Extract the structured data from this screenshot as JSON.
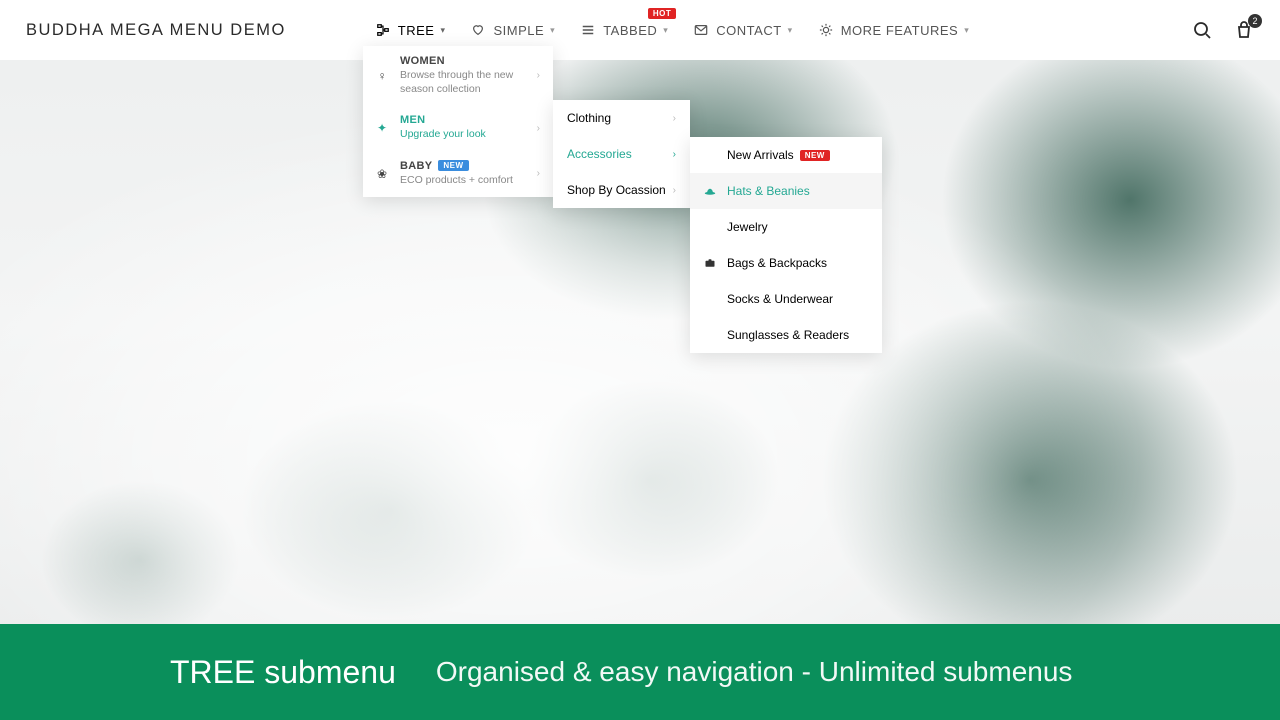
{
  "header": {
    "logo": "BUDDHA MEGA MENU DEMO",
    "nav": [
      {
        "label": "TREE",
        "icon": "tree"
      },
      {
        "label": "SIMPLE",
        "icon": "heart"
      },
      {
        "label": "TABBED",
        "icon": "lines",
        "badge": "HOT"
      },
      {
        "label": "CONTACT",
        "icon": "mail"
      },
      {
        "label": "MORE FEATURES",
        "icon": "bulb"
      }
    ],
    "cart_count": "2"
  },
  "tree_menu": {
    "level1": [
      {
        "title": "WOMEN",
        "sub": "Browse through the new season collection",
        "icon": "woman"
      },
      {
        "title": "MEN",
        "sub": "Upgrade your look",
        "icon": "man",
        "active": true
      },
      {
        "title": "BABY",
        "sub": "ECO products + comfort",
        "icon": "baby",
        "badge": "NEW"
      }
    ],
    "level2": [
      {
        "label": "Clothing"
      },
      {
        "label": "Accessories",
        "active": true
      },
      {
        "label": "Shop By Ocassion"
      }
    ],
    "level3": [
      {
        "label": "New Arrivals",
        "badge": "NEW"
      },
      {
        "label": "Hats & Beanies",
        "active": true,
        "icon": "hat"
      },
      {
        "label": "Jewelry"
      },
      {
        "label": "Bags & Backpacks",
        "icon": "bag"
      },
      {
        "label": "Socks & Underwear"
      },
      {
        "label": "Sunglasses & Readers"
      }
    ]
  },
  "banner": {
    "title": "TREE submenu",
    "subtitle": "Organised & easy navigation - Unlimited submenus"
  },
  "colors": {
    "accent": "#24a893",
    "brand_green": "#0a8f5b",
    "hot": "#e02424",
    "new": "#3a8dde"
  }
}
